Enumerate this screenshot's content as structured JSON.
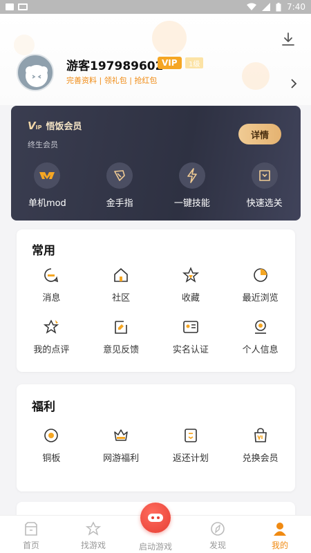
{
  "status": {
    "time": "7:40"
  },
  "profile": {
    "username": "游客197989602",
    "vip_badge": "VIP",
    "level_badge": "1级",
    "links": "完善资料 | 领礼包 | 抢红包"
  },
  "vip_card": {
    "logo_mark": "V",
    "logo_sub": "IP",
    "title": "悟饭会员",
    "subtitle": "终生会员",
    "details_label": "详情",
    "items": [
      {
        "label": "单机mod",
        "icon": "mod-icon"
      },
      {
        "label": "金手指",
        "icon": "golden-finger-icon"
      },
      {
        "label": "一键技能",
        "icon": "lightning-icon"
      },
      {
        "label": "快速选关",
        "icon": "level-select-icon"
      }
    ]
  },
  "common": {
    "title": "常用",
    "items": [
      {
        "label": "消息",
        "icon": "message-icon"
      },
      {
        "label": "社区",
        "icon": "community-icon"
      },
      {
        "label": "收藏",
        "icon": "star-icon"
      },
      {
        "label": "最近浏览",
        "icon": "history-icon"
      },
      {
        "label": "我的点评",
        "icon": "review-icon"
      },
      {
        "label": "意见反馈",
        "icon": "feedback-icon"
      },
      {
        "label": "实名认证",
        "icon": "id-card-icon"
      },
      {
        "label": "个人信息",
        "icon": "person-icon"
      }
    ]
  },
  "welfare": {
    "title": "福利",
    "items": [
      {
        "label": "铜板",
        "icon": "coin-icon"
      },
      {
        "label": "网游福利",
        "icon": "crown-icon"
      },
      {
        "label": "返还计划",
        "icon": "rebate-icon"
      },
      {
        "label": "兑换会员",
        "icon": "vip-bag-icon"
      }
    ]
  },
  "bottom_nav": {
    "items": [
      {
        "label": "首页",
        "icon": "home-icon"
      },
      {
        "label": "找游戏",
        "icon": "star-outline-icon"
      },
      {
        "label": "启动游戏",
        "icon": "gamepad-icon"
      },
      {
        "label": "发现",
        "icon": "compass-icon"
      },
      {
        "label": "我的",
        "icon": "user-icon"
      }
    ],
    "active_index": 4
  },
  "colors": {
    "accent": "#f08a12",
    "vip_card_bg": "#33364a",
    "launch_button": "#e63f34"
  }
}
